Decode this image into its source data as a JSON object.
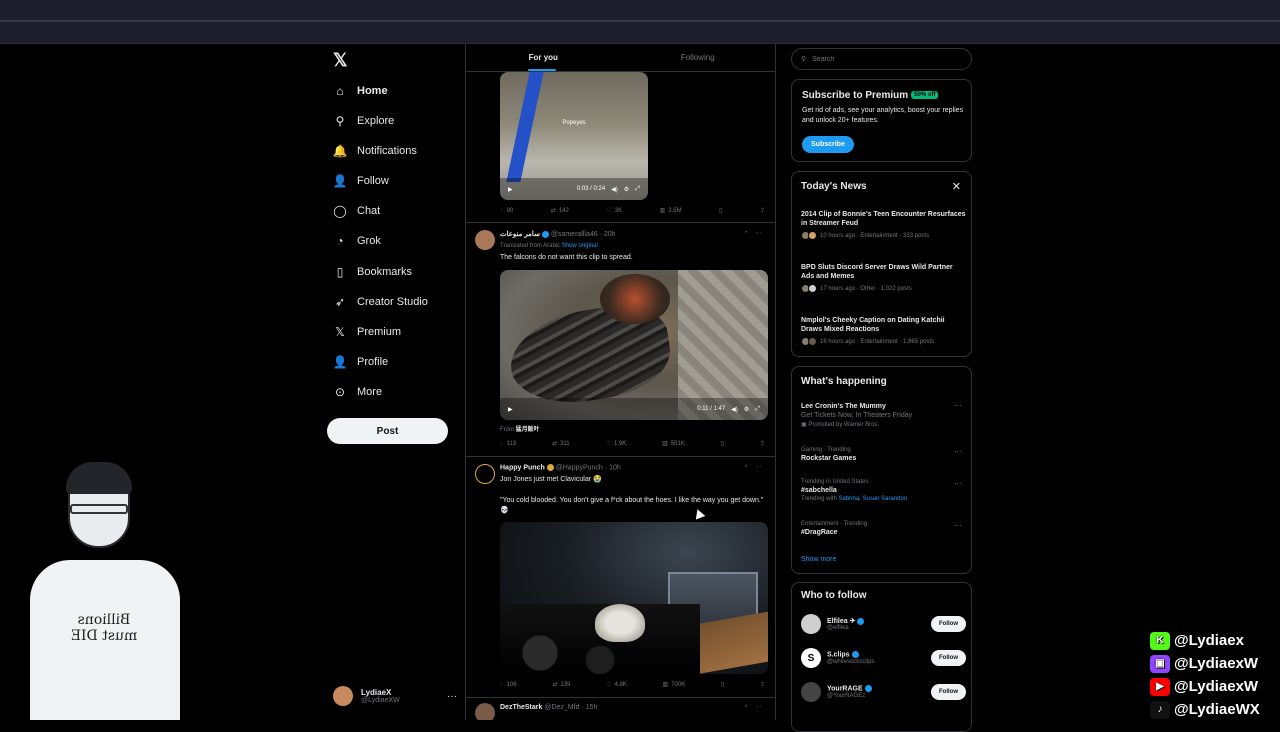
{
  "nav": {
    "items": [
      {
        "label": "Home",
        "icon": "home-icon",
        "glyph": "⌂"
      },
      {
        "label": "Explore",
        "icon": "search-icon",
        "glyph": "⚲"
      },
      {
        "label": "Notifications",
        "icon": "bell-icon",
        "glyph": "🔔"
      },
      {
        "label": "Follow",
        "icon": "person-plus-icon",
        "glyph": "👤"
      },
      {
        "label": "Chat",
        "icon": "chat-bubble-icon",
        "glyph": "◯"
      },
      {
        "label": "Grok",
        "icon": "grok-icon",
        "glyph": "◔"
      },
      {
        "label": "Bookmarks",
        "icon": "bookmark-icon",
        "glyph": "▯"
      },
      {
        "label": "Creator Studio",
        "icon": "rocket-icon",
        "glyph": "➶"
      },
      {
        "label": "Premium",
        "icon": "x-logo-icon",
        "glyph": "𝕏"
      },
      {
        "label": "Profile",
        "icon": "person-icon",
        "glyph": "👤"
      },
      {
        "label": "More",
        "icon": "more-circle-icon",
        "glyph": "⊙"
      }
    ],
    "post_label": "Post",
    "account": {
      "name": "LydiaeX",
      "handle": "@LydiaeXW"
    }
  },
  "feed": {
    "tabs": [
      "For you",
      "Following"
    ],
    "tweet1": {
      "video_caption": "Popeyes",
      "time": "0:03 / 0:24",
      "replies": "90",
      "reposts": "142",
      "likes": "3K",
      "views": "3.5M"
    },
    "tweet2": {
      "name": "سامر منوعات",
      "handle": "@samerallla46 · 20h",
      "translated": "Translated from Arabic",
      "show_original": "Show original",
      "text": "The falcons do not want this clip to spread.",
      "time": "0:11 / 1:47",
      "from_label": "From",
      "from_name": "猛月飯叶",
      "replies": "113",
      "reposts": "311",
      "likes": "1.9K",
      "views": "551K"
    },
    "tweet3": {
      "name": "Happy Punch",
      "handle": "@HappyPunch · 10h",
      "text1": "Jon Jones just met Clavicular 😭",
      "text2": "\"You cold blooded. You don't give a f*ck about the hoes. I like the way you get down.\" 💀",
      "replies": "106",
      "reposts": "139",
      "likes": "4.8K",
      "views": "700K"
    },
    "tweet4": {
      "name": "DezTheStark",
      "handle": "@Dez_Mfd · 15h"
    }
  },
  "search": {
    "placeholder": "Search"
  },
  "premium": {
    "title": "Subscribe to Premium",
    "badge": "50% off",
    "text": "Get rid of ads, see your analytics, boost your replies and unlock 20+ features.",
    "button": "Subscribe"
  },
  "news": {
    "title": "Today's News",
    "items": [
      {
        "title": "2014 Clip of Bonnie's Teen Encounter Resurfaces in Streamer Feud",
        "meta": "10 hours ago · Entertainment · 333 posts"
      },
      {
        "title": "BPD Sluts Discord Server Draws Wild Partner Ads and Memes",
        "meta": "17 hours ago · Other · 1,022 posts"
      },
      {
        "title": "Nmplol's Cheeky Caption on Dating Katchii Draws Mixed Reactions",
        "meta": "16 hours ago · Entertainment · 1,865 posts"
      }
    ]
  },
  "happening": {
    "title": "What's happening",
    "items": [
      {
        "cat": "",
        "title": "Lee Cronin's The Mummy",
        "sub": "Get Tickets Now, In Theaters Friday",
        "promo": "Promoted by Warner Bros."
      },
      {
        "cat": "Gaming · Trending",
        "title": "Rockstar Games",
        "sub": "",
        "promo": ""
      },
      {
        "cat": "Trending in United States",
        "title": "#sabchella",
        "sub": "Trending with",
        "links": "Sabrina, Susan Sarandon",
        "promo": ""
      },
      {
        "cat": "Entertainment · Trending",
        "title": "#DragRace",
        "sub": "",
        "promo": ""
      }
    ],
    "show_more": "Show more"
  },
  "who_to_follow": {
    "title": "Who to follow",
    "users": [
      {
        "name": "Elfilea ✈",
        "handle": "@elfilea",
        "color": "#cfcfcf"
      },
      {
        "name": "S.clips",
        "handle": "@whitesocksclips",
        "color": "#ffffff"
      },
      {
        "name": "YourRAGE",
        "handle": "@YourRAGEz",
        "color": "#444444"
      }
    ],
    "follow_label": "Follow"
  },
  "overlay": {
    "shirt_text": "Billions must DIE",
    "socials": [
      {
        "platform": "kick-icon",
        "glyph": "K",
        "color": "#53fc18",
        "handle": "@Lydiaex"
      },
      {
        "platform": "twitch-icon",
        "glyph": "▣",
        "color": "#9146ff",
        "handle": "@LydiaexW"
      },
      {
        "platform": "youtube-icon",
        "glyph": "▶",
        "color": "#ff0000",
        "handle": "@LydiaexW"
      },
      {
        "platform": "tiktok-icon",
        "glyph": "♪",
        "color": "#111111",
        "handle": "@LydiaeWX"
      }
    ]
  }
}
